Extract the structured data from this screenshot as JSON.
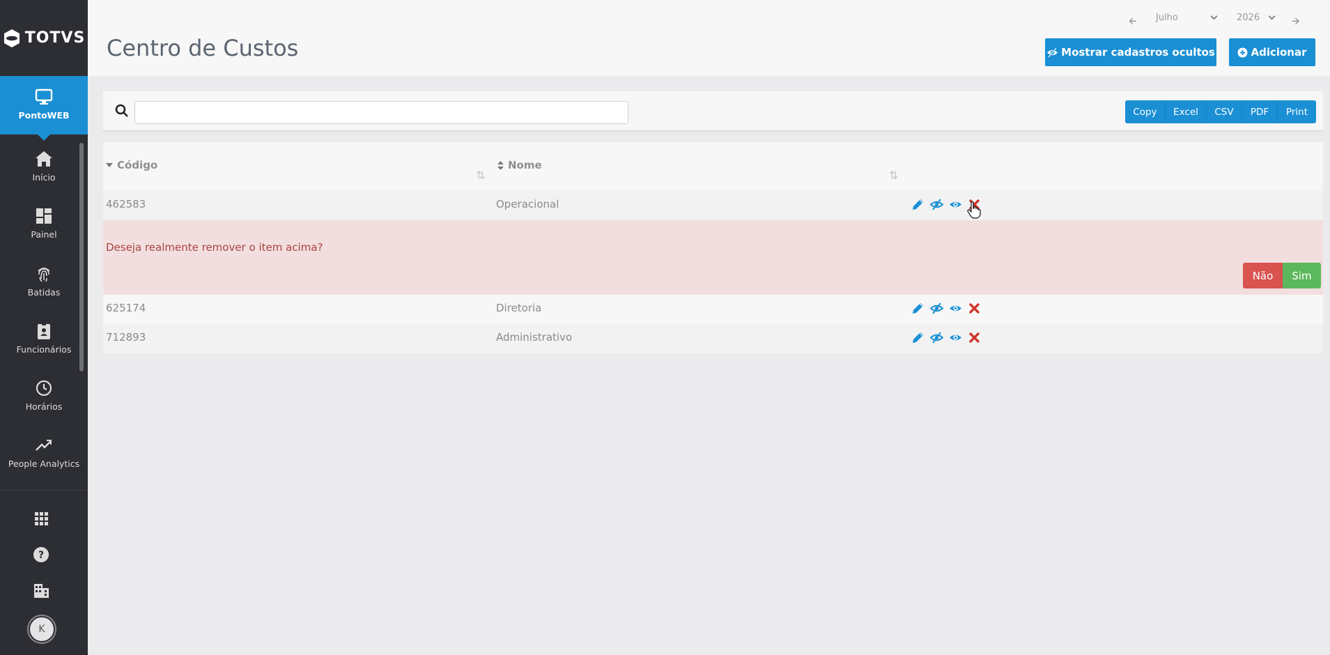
{
  "app": {
    "brand": "TOTVS"
  },
  "sidebar": {
    "items": [
      {
        "label": "PontoWEB",
        "icon": "monitor-icon",
        "active": true
      },
      {
        "label": "Início",
        "icon": "home-icon"
      },
      {
        "label": "Painel",
        "icon": "dashboard-icon"
      },
      {
        "label": "Batidas",
        "icon": "fingerprint-icon"
      },
      {
        "label": "Funcionários",
        "icon": "id-badge-icon"
      },
      {
        "label": "Horários",
        "icon": "clock-icon"
      },
      {
        "label": "People Analytics",
        "icon": "trending-up-icon"
      }
    ],
    "bottom": [
      "apps-grid-icon",
      "help-icon",
      "building-icon"
    ],
    "avatar_initial": "K"
  },
  "header": {
    "title": "Centro de Custos",
    "period": {
      "month": "Julho",
      "year": "2026"
    },
    "show_hidden_label": "Mostrar cadastros ocultos",
    "add_label": "Adicionar"
  },
  "search": {
    "value": "",
    "placeholder": ""
  },
  "export": [
    "Copy",
    "Excel",
    "CSV",
    "PDF",
    "Print"
  ],
  "table": {
    "columns": [
      "Código",
      "Nome"
    ],
    "rows": [
      {
        "code": "462583",
        "name": "Operacional"
      },
      {
        "code": "625174",
        "name": "Diretoria"
      },
      {
        "code": "712893",
        "name": "Administrativo"
      }
    ],
    "confirm": {
      "message": "Deseja realmente remover o item acima?",
      "no": "Não",
      "yes": "Sim"
    }
  },
  "colors": {
    "sidebar": "#2d2e33",
    "accent": "#1a8fd4",
    "danger": "#d9534f",
    "success": "#5cb85c",
    "confirm_bg": "#f2dede",
    "delete_icon": "#d0342c"
  }
}
